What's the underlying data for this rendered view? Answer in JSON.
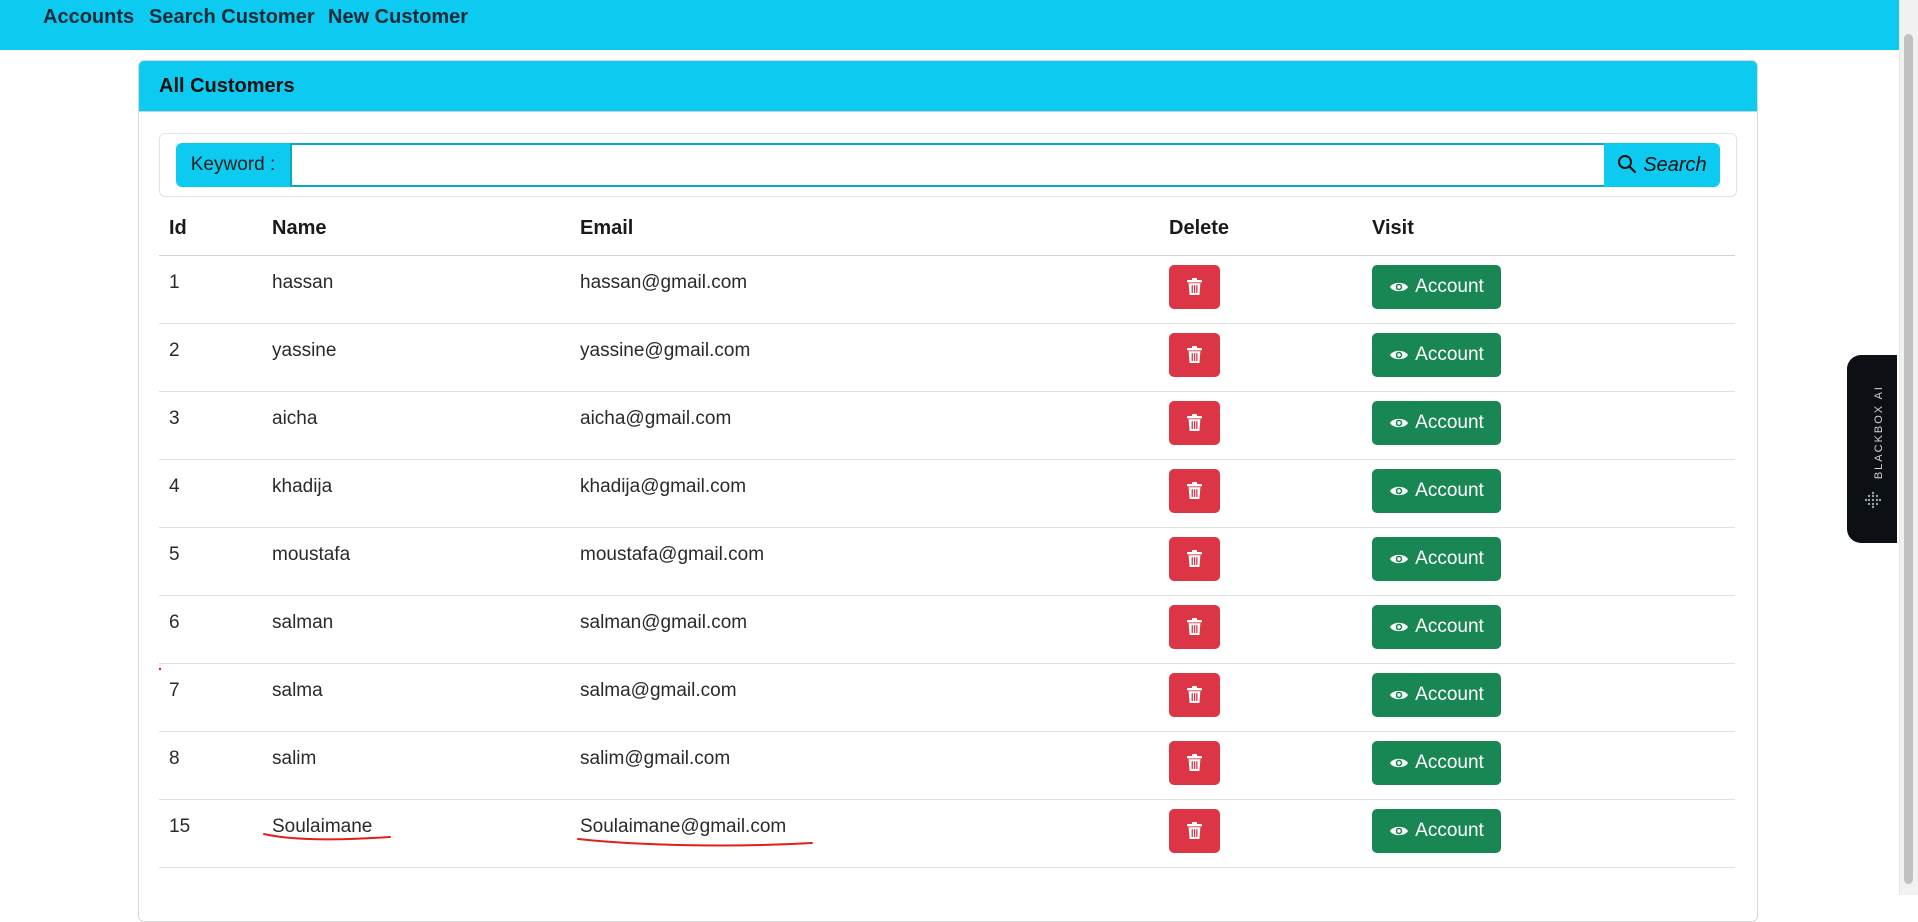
{
  "nav": {
    "items": [
      "Accounts",
      "Search Customer",
      "New Customer"
    ]
  },
  "card": {
    "title": "All Customers",
    "search": {
      "label": "Keyword :",
      "value": "",
      "button": "Search"
    },
    "table": {
      "headers": [
        "Id",
        "Name",
        "Email",
        "Delete",
        "Visit"
      ],
      "rows": [
        {
          "id": "1",
          "name": "hassan",
          "email": "hassan@gmail.com",
          "visit": "Account"
        },
        {
          "id": "2",
          "name": "yassine",
          "email": "yassine@gmail.com",
          "visit": "Account"
        },
        {
          "id": "3",
          "name": "aicha",
          "email": "aicha@gmail.com",
          "visit": "Account"
        },
        {
          "id": "4",
          "name": "khadija",
          "email": "khadija@gmail.com",
          "visit": "Account"
        },
        {
          "id": "5",
          "name": "moustafa",
          "email": "moustafa@gmail.com",
          "visit": "Account"
        },
        {
          "id": "6",
          "name": "salman",
          "email": "salman@gmail.com",
          "visit": "Account"
        },
        {
          "id": "7",
          "name": "salma",
          "email": "salma@gmail.com",
          "visit": "Account"
        },
        {
          "id": "8",
          "name": "salim",
          "email": "salim@gmail.com",
          "visit": "Account"
        },
        {
          "id": "15",
          "name": "Soulaimane",
          "email": "Soulaimane@gmail.com",
          "visit": "Account"
        }
      ]
    }
  },
  "side_widget": {
    "label": "BLACKBOX AI"
  },
  "icons": {
    "search": "search-icon",
    "delete": "trash-icon",
    "visit": "eye-icon",
    "widget": "dots-grid-icon"
  },
  "colors": {
    "navbar": "#0dcaf0",
    "delete_button": "#dc3545",
    "account_button": "#198754",
    "annotation": "#e0201b"
  }
}
